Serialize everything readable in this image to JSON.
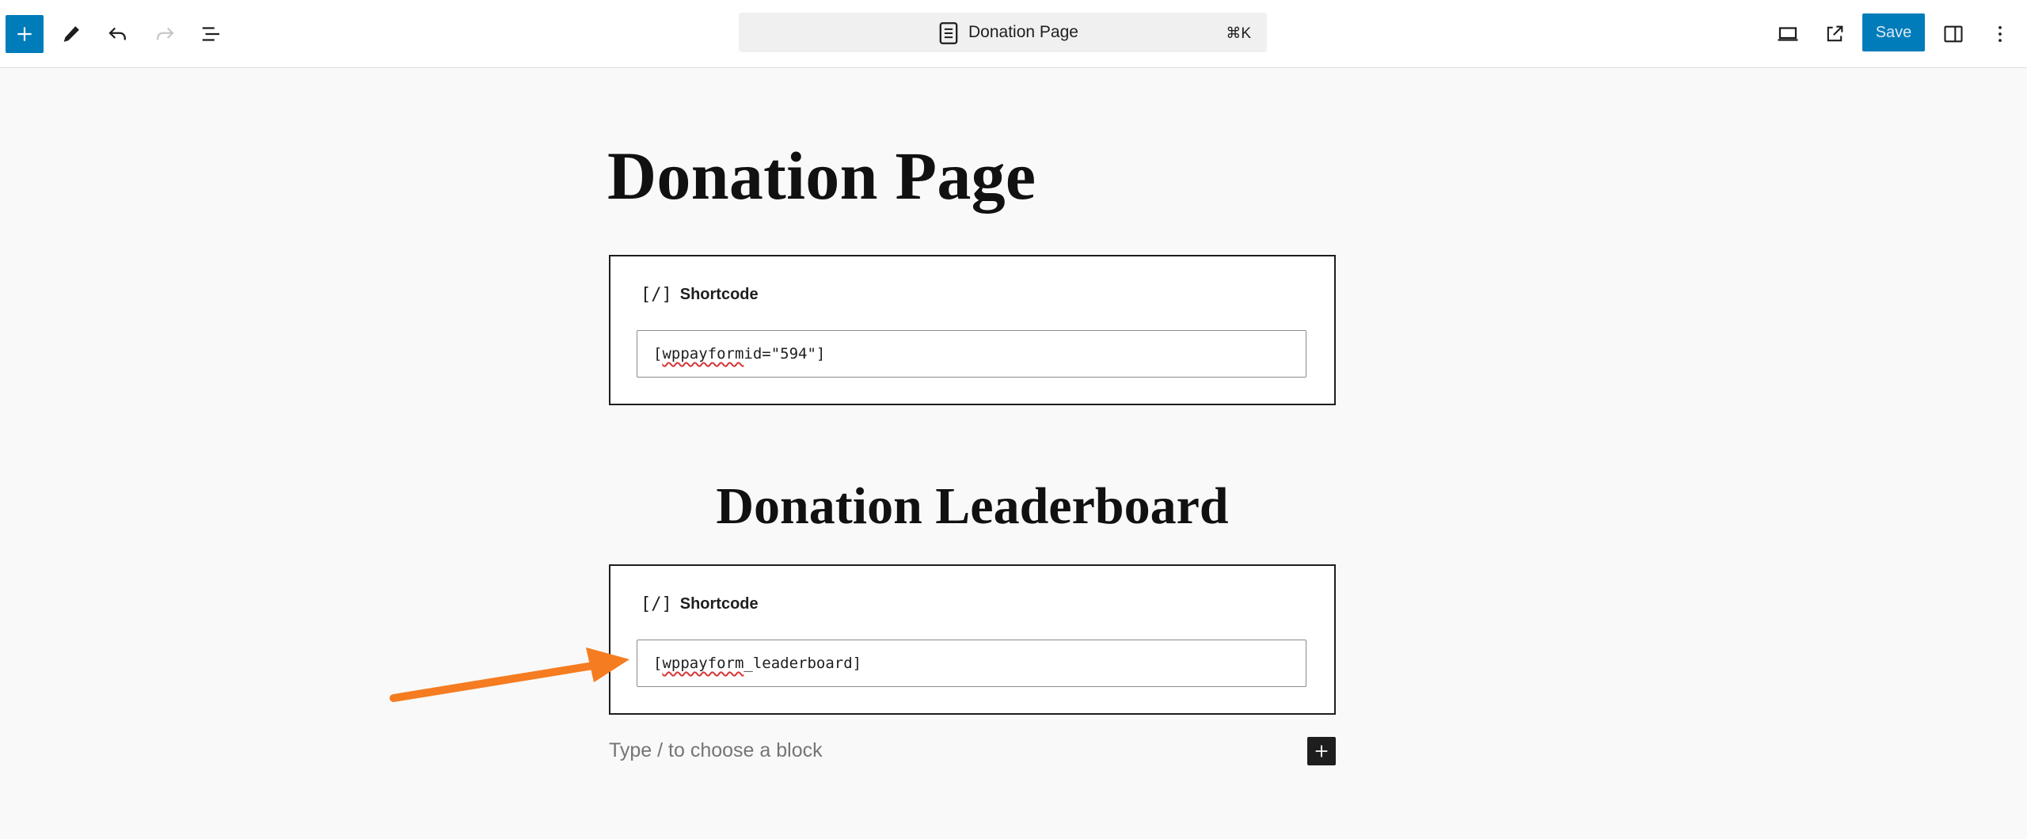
{
  "toolbar": {
    "inserter_icon": "plus-icon",
    "tools_icon": "pencil-icon",
    "undo_icon": "undo-icon",
    "redo_icon": "redo-icon",
    "document_overview_icon": "list-view-icon",
    "command": {
      "icon": "page-icon",
      "title": "Donation Page",
      "shortcut": "⌘K"
    },
    "view_icon": "laptop-icon",
    "preview_icon": "external-link-icon",
    "save_label": "Save",
    "settings_icon": "sidebar-icon",
    "options_icon": "more-vertical-icon"
  },
  "content": {
    "title": "Donation Page",
    "blocks": [
      {
        "type": "shortcode",
        "icon": "[/]",
        "label": "Shortcode",
        "code_word": "wppayform",
        "code_rest": " id=\"594\"]"
      },
      {
        "type": "heading",
        "text": "Donation Leaderboard"
      },
      {
        "type": "shortcode",
        "icon": "[/]",
        "label": "Shortcode",
        "code_word": "wppayform",
        "code_rest": "_leaderboard]"
      }
    ],
    "appender_placeholder": "Type / to choose a block"
  },
  "annotation": {
    "type": "arrow",
    "color": "#f57c20"
  },
  "colors": {
    "accent": "#007cba",
    "arrow": "#f57c20",
    "spell_underline": "#d63638"
  }
}
